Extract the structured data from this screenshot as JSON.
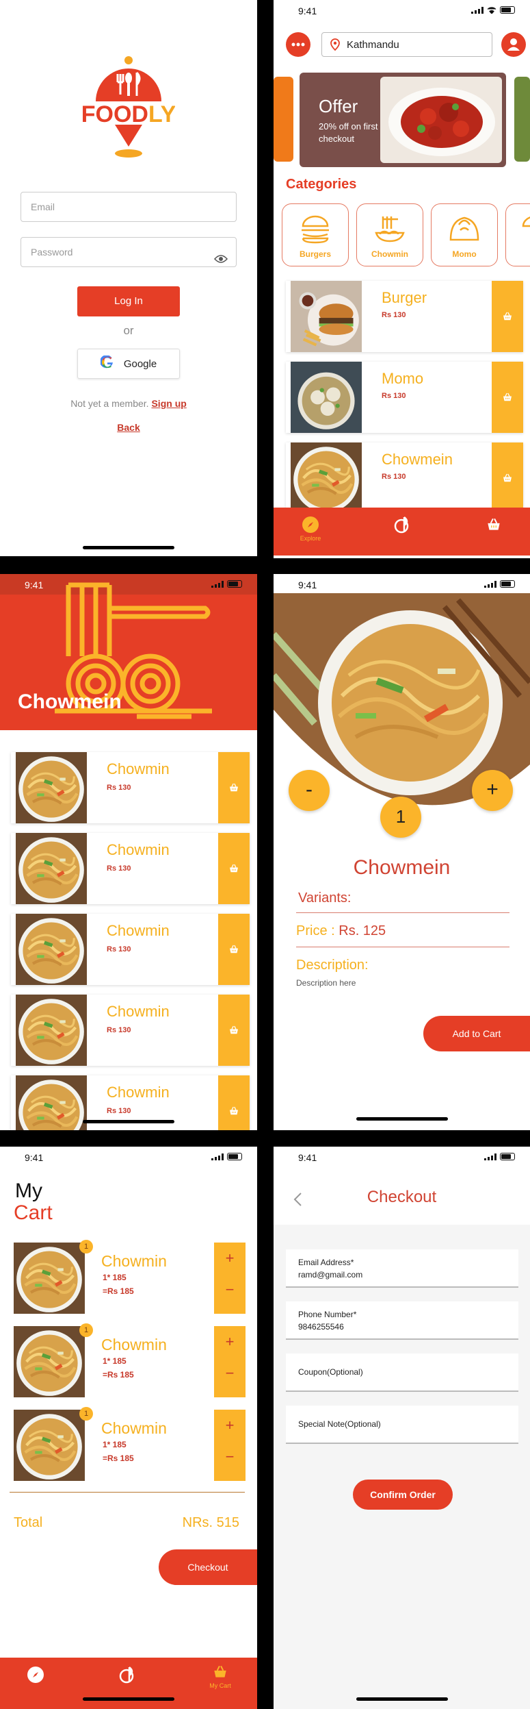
{
  "login": {
    "brand": "FOODLY",
    "email_placeholder": "Email",
    "password_placeholder": "Password",
    "login_button": "Log In",
    "or_text": "or",
    "google_button": "Google",
    "member_prompt": "Not yet a member.",
    "signup_link": "Sign up",
    "back_link": "Back"
  },
  "status": {
    "time": "9:41"
  },
  "home": {
    "location": "Kathmandu",
    "offer": {
      "title": "Offer",
      "subtitle": "20% off on first checkout"
    },
    "categories_title": "Categories",
    "categories": [
      "Burgers",
      "Chowmin",
      "Momo"
    ],
    "foods": [
      {
        "name": "Burger",
        "price": "Rs 130"
      },
      {
        "name": "Momo",
        "price": "Rs 130"
      },
      {
        "name": "Chowmein",
        "price": "Rs 130"
      }
    ],
    "nav": {
      "explore": "Explore"
    }
  },
  "category": {
    "title": "Chowmein",
    "items": [
      {
        "name": "Chowmin",
        "price": "Rs 130"
      },
      {
        "name": "Chowmin",
        "price": "Rs 130"
      },
      {
        "name": "Chowmin",
        "price": "Rs 130"
      },
      {
        "name": "Chowmin",
        "price": "Rs 130"
      },
      {
        "name": "Chowmin",
        "price": "Rs 130"
      }
    ]
  },
  "detail": {
    "minus": "-",
    "plus": "+",
    "quantity": "1",
    "title": "Chowmein",
    "variants_label": "Variants:",
    "price_label": "Price :",
    "price_value": "Rs. 125",
    "description_label": "Description:",
    "description_text": "Description here",
    "add_to_cart": "Add to Cart"
  },
  "cart": {
    "title_line1": "My",
    "title_line2": "Cart",
    "items": [
      {
        "badge": "1",
        "name": "Chowmin",
        "qty": "1* 185",
        "price": "=Rs 185"
      },
      {
        "badge": "1",
        "name": "Chowmin",
        "qty": "1* 185",
        "price": "=Rs 185"
      },
      {
        "badge": "1",
        "name": "Chowmin",
        "qty": "1* 185",
        "price": "=Rs 185"
      }
    ],
    "plus": "+",
    "minus": "−",
    "total_label": "Total",
    "total_value": "NRs. 515",
    "checkout_button": "Checkout",
    "nav_label": "My Cart"
  },
  "checkout": {
    "title": "Checkout",
    "email_label": "Email Address*",
    "email_value": "ramd@gmail.com",
    "phone_label": "Phone Number*",
    "phone_value": "9846255546",
    "coupon_placeholder": "Coupon(Optional)",
    "note_placeholder": "Special Note(Optional)",
    "confirm_button": "Confirm Order"
  },
  "colors": {
    "primary": "#e53e26",
    "accent": "#fbb42a",
    "text_accent": "#f5b01f"
  }
}
